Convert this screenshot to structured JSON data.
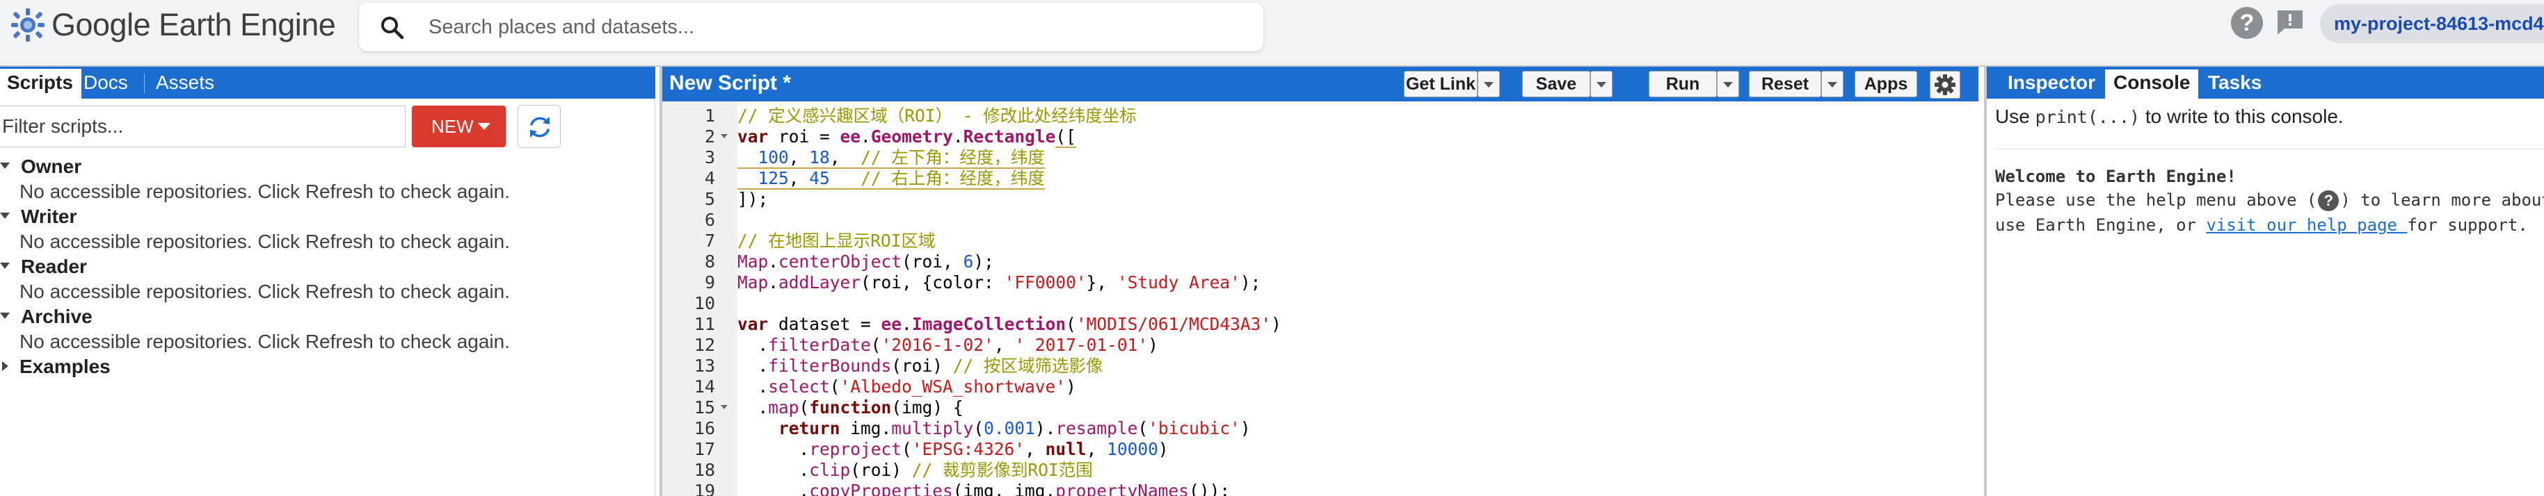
{
  "header": {
    "app_title": "Google Earth Engine",
    "search_placeholder": "Search places and datasets...",
    "project_name": "my-project-84613-mcd4",
    "help_icon_glyph": "?",
    "logo_icon": "earth-engine-logo-icon",
    "search_icon": "search-icon",
    "feedback_icon": "feedback-icon"
  },
  "left_panel": {
    "tabs": [
      {
        "label": "Scripts",
        "active": true
      },
      {
        "label": "Docs",
        "active": false
      },
      {
        "label": "Assets",
        "active": false
      }
    ],
    "filter_placeholder": "Filter scripts...",
    "new_label": "NEW",
    "refresh_icon": "refresh-icon",
    "tree": [
      {
        "label": "Owner",
        "expanded": true,
        "message": "No accessible repositories. Click Refresh to check again."
      },
      {
        "label": "Writer",
        "expanded": true,
        "message": "No accessible repositories. Click Refresh to check again."
      },
      {
        "label": "Reader",
        "expanded": true,
        "message": "No accessible repositories. Click Refresh to check again."
      },
      {
        "label": "Archive",
        "expanded": true,
        "message": "No accessible repositories. Click Refresh to check again."
      },
      {
        "label": "Examples",
        "expanded": false,
        "message": ""
      }
    ]
  },
  "editor": {
    "script_title": "New Script *",
    "buttons": {
      "get_link": "Get Link",
      "save": "Save",
      "run": "Run",
      "reset": "Reset",
      "apps": "Apps"
    },
    "settings_icon": "gear-icon",
    "lines": [
      {
        "n": "1",
        "fold": false,
        "tokens": [
          {
            "t": "// 定义感兴趣区域（ROI） - 修改此处经纬度坐标",
            "c": "comment"
          }
        ]
      },
      {
        "n": "2",
        "fold": true,
        "tokens": [
          {
            "t": "var",
            "c": "kw"
          },
          {
            "t": " roi = ",
            "c": ""
          },
          {
            "t": "ee",
            "c": "ee"
          },
          {
            "t": ".",
            "c": ""
          },
          {
            "t": "Geometry",
            "c": "ee"
          },
          {
            "t": ".",
            "c": ""
          },
          {
            "t": "Rectangle",
            "c": "ee"
          },
          {
            "t": "([",
            "c": "",
            "hl": true
          }
        ]
      },
      {
        "n": "3",
        "fold": false,
        "tokens": [
          {
            "t": "  ",
            "c": "",
            "hl": true
          },
          {
            "t": "100",
            "c": "num",
            "hl": true
          },
          {
            "t": ", ",
            "c": "",
            "hl": true
          },
          {
            "t": "18",
            "c": "num",
            "hl": true
          },
          {
            "t": ",  ",
            "c": "",
            "hl": true
          },
          {
            "t": "// 左下角：经度，纬度",
            "c": "comment",
            "hl": true
          }
        ]
      },
      {
        "n": "4",
        "fold": false,
        "tokens": [
          {
            "t": "  ",
            "c": "",
            "hl": true
          },
          {
            "t": "125",
            "c": "num",
            "hl": true
          },
          {
            "t": ", ",
            "c": "",
            "hl": true
          },
          {
            "t": "45",
            "c": "num",
            "hl": true
          },
          {
            "t": "   ",
            "c": "",
            "hl": true
          },
          {
            "t": "// 右上角：经度，纬度",
            "c": "comment",
            "hl": true
          }
        ]
      },
      {
        "n": "5",
        "fold": false,
        "tokens": [
          {
            "t": "]);",
            "c": ""
          }
        ]
      },
      {
        "n": "6",
        "fold": false,
        "tokens": []
      },
      {
        "n": "7",
        "fold": false,
        "tokens": [
          {
            "t": "// 在地图上显示ROI区域",
            "c": "comment"
          }
        ]
      },
      {
        "n": "8",
        "fold": false,
        "tokens": [
          {
            "t": "Map",
            "c": "map"
          },
          {
            "t": ".",
            "c": ""
          },
          {
            "t": "centerObject",
            "c": "map"
          },
          {
            "t": "(roi, ",
            "c": ""
          },
          {
            "t": "6",
            "c": "num"
          },
          {
            "t": ");",
            "c": ""
          }
        ]
      },
      {
        "n": "9",
        "fold": false,
        "tokens": [
          {
            "t": "Map",
            "c": "map"
          },
          {
            "t": ".",
            "c": ""
          },
          {
            "t": "addLayer",
            "c": "map"
          },
          {
            "t": "(roi, {color: ",
            "c": ""
          },
          {
            "t": "'FF0000'",
            "c": "str"
          },
          {
            "t": "}, ",
            "c": ""
          },
          {
            "t": "'Study Area'",
            "c": "str"
          },
          {
            "t": ");",
            "c": ""
          }
        ]
      },
      {
        "n": "10",
        "fold": false,
        "tokens": []
      },
      {
        "n": "11",
        "fold": false,
        "tokens": [
          {
            "t": "var",
            "c": "kw"
          },
          {
            "t": " dataset = ",
            "c": ""
          },
          {
            "t": "ee",
            "c": "ee"
          },
          {
            "t": ".",
            "c": ""
          },
          {
            "t": "ImageCollection",
            "c": "ee"
          },
          {
            "t": "(",
            "c": ""
          },
          {
            "t": "'MODIS/061/MCD43A3'",
            "c": "str"
          },
          {
            "t": ")",
            "c": ""
          }
        ]
      },
      {
        "n": "12",
        "fold": false,
        "tokens": [
          {
            "t": "  .",
            "c": ""
          },
          {
            "t": "filterDate",
            "c": "fn"
          },
          {
            "t": "(",
            "c": ""
          },
          {
            "t": "'2016-1-02'",
            "c": "str"
          },
          {
            "t": ", ",
            "c": ""
          },
          {
            "t": "' 2017-01-01'",
            "c": "str"
          },
          {
            "t": ")",
            "c": ""
          }
        ]
      },
      {
        "n": "13",
        "fold": false,
        "tokens": [
          {
            "t": "  .",
            "c": ""
          },
          {
            "t": "filterBounds",
            "c": "fn"
          },
          {
            "t": "(roi) ",
            "c": ""
          },
          {
            "t": "// 按区域筛选影像",
            "c": "comment"
          }
        ]
      },
      {
        "n": "14",
        "fold": false,
        "tokens": [
          {
            "t": "  .",
            "c": ""
          },
          {
            "t": "select",
            "c": "fn"
          },
          {
            "t": "(",
            "c": ""
          },
          {
            "t": "'Albedo_WSA_shortwave'",
            "c": "str"
          },
          {
            "t": ")",
            "c": ""
          }
        ]
      },
      {
        "n": "15",
        "fold": true,
        "tokens": [
          {
            "t": "  .",
            "c": ""
          },
          {
            "t": "map",
            "c": "fn"
          },
          {
            "t": "(",
            "c": ""
          },
          {
            "t": "function",
            "c": "kw"
          },
          {
            "t": "(img) {",
            "c": ""
          }
        ]
      },
      {
        "n": "16",
        "fold": false,
        "tokens": [
          {
            "t": "    ",
            "c": ""
          },
          {
            "t": "return",
            "c": "kw"
          },
          {
            "t": " img.",
            "c": ""
          },
          {
            "t": "multiply",
            "c": "fn"
          },
          {
            "t": "(",
            "c": ""
          },
          {
            "t": "0.001",
            "c": "num"
          },
          {
            "t": ").",
            "c": ""
          },
          {
            "t": "resample",
            "c": "fn"
          },
          {
            "t": "(",
            "c": ""
          },
          {
            "t": "'bicubic'",
            "c": "str"
          },
          {
            "t": ")",
            "c": ""
          }
        ]
      },
      {
        "n": "17",
        "fold": false,
        "tokens": [
          {
            "t": "      .",
            "c": ""
          },
          {
            "t": "reproject",
            "c": "fn"
          },
          {
            "t": "(",
            "c": ""
          },
          {
            "t": "'EPSG:4326'",
            "c": "str"
          },
          {
            "t": ", ",
            "c": ""
          },
          {
            "t": "null",
            "c": "bool"
          },
          {
            "t": ", ",
            "c": ""
          },
          {
            "t": "10000",
            "c": "num"
          },
          {
            "t": ")",
            "c": ""
          }
        ]
      },
      {
        "n": "18",
        "fold": false,
        "tokens": [
          {
            "t": "      .",
            "c": ""
          },
          {
            "t": "clip",
            "c": "fn"
          },
          {
            "t": "(roi) ",
            "c": ""
          },
          {
            "t": "// 裁剪影像到ROI范围",
            "c": "comment"
          }
        ]
      },
      {
        "n": "19",
        "fold": false,
        "tokens": [
          {
            "t": "      .",
            "c": ""
          },
          {
            "t": "copyProperties",
            "c": "fn"
          },
          {
            "t": "(img, img.",
            "c": ""
          },
          {
            "t": "propertyNames",
            "c": "fn"
          },
          {
            "t": "());",
            "c": ""
          }
        ]
      }
    ]
  },
  "right_panel": {
    "tabs": [
      {
        "label": "Inspector",
        "active": false
      },
      {
        "label": "Console",
        "active": true
      },
      {
        "label": "Tasks",
        "active": false
      }
    ],
    "console": {
      "hint_prefix": "Use ",
      "hint_code": "print(...)",
      "hint_suffix": " to write to this console.",
      "welcome": "Welcome to Earth Engine!",
      "help_line1_prefix": "Please use the help menu above (",
      "help_icon_glyph": "?",
      "help_line1_suffix": ") to learn more about",
      "help_line2_prefix": "use Earth Engine, or ",
      "help_link": "visit our help page ",
      "help_line2_suffix": "for support."
    }
  },
  "colors": {
    "accent_blue": "#1c6fd1",
    "new_button_red": "#d93a2b",
    "project_text": "#1a4bb5"
  }
}
